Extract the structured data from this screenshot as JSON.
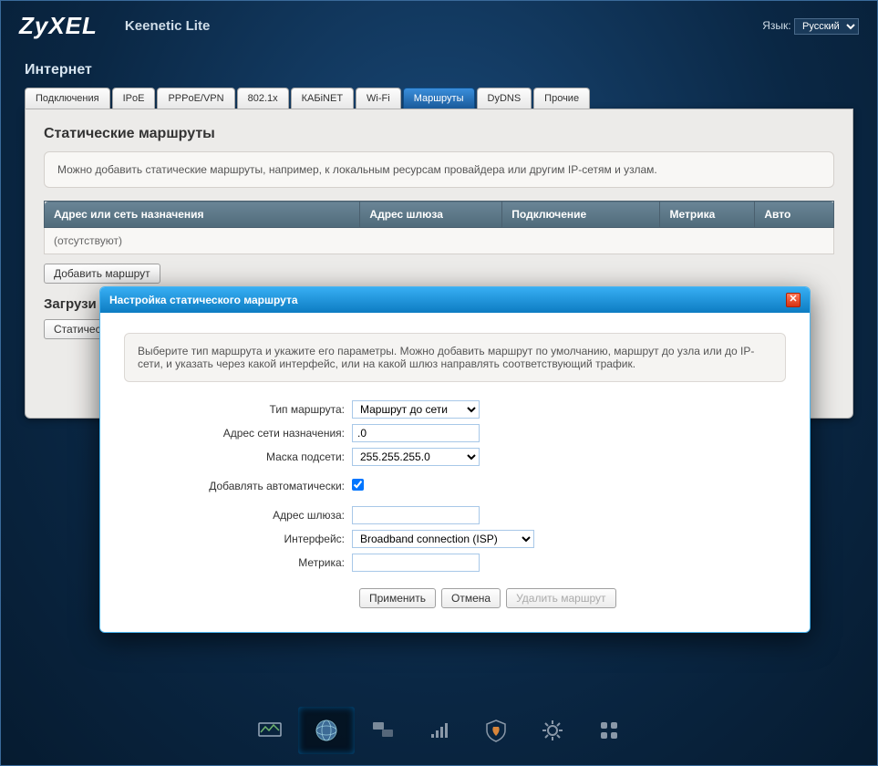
{
  "header": {
    "logo": "ZyXEL",
    "model": "Keenetic Lite",
    "lang_label": "Язык:",
    "lang_value": "Русский"
  },
  "breadcrumb": "Интернет",
  "tabs": [
    {
      "label": "Подключения"
    },
    {
      "label": "IPoE"
    },
    {
      "label": "PPPoE/VPN"
    },
    {
      "label": "802.1x"
    },
    {
      "label": "КАБiNET"
    },
    {
      "label": "Wi-Fi"
    },
    {
      "label": "Маршруты",
      "active": true
    },
    {
      "label": "DyDNS"
    },
    {
      "label": "Прочие"
    }
  ],
  "panel": {
    "title": "Статические маршруты",
    "info": "Можно добавить статические маршруты, например, к локальным ресурсам провайдера или другим IP-сетям и узлам.",
    "columns": {
      "dest": "Адрес или сеть назначения",
      "gateway": "Адрес шлюза",
      "conn": "Подключение",
      "metric": "Метрика",
      "auto": "Авто"
    },
    "empty_row": "(отсутствуют)",
    "add_btn": "Добавить маршрут",
    "load_title": "Загрузи",
    "load_btn_prefix": "Статичес"
  },
  "dialog": {
    "title": "Настройка статического маршрута",
    "info": "Выберите тип маршрута и укажите его параметры. Можно добавить маршрут по умолчанию, маршрут до узла или до IP-сети, и указать через какой интерфейс, или на какой шлюз направлять соответствующий трафик.",
    "fields": {
      "type_label": "Тип маршрута:",
      "type_value": "Маршрут до сети",
      "dest_label": "Адрес сети назначения:",
      "dest_value": ".0",
      "mask_label": "Маска подсети:",
      "mask_value": "255.255.255.0",
      "auto_label": "Добавлять автоматически:",
      "auto_checked": true,
      "gateway_label": "Адрес шлюза:",
      "gateway_value": "",
      "iface_label": "Интерфейс:",
      "iface_value": "Broadband connection (ISP)",
      "metric_label": "Метрика:",
      "metric_value": ""
    },
    "buttons": {
      "apply": "Применить",
      "cancel": "Отмена",
      "delete": "Удалить маршрут"
    }
  },
  "dock": {
    "items": [
      "monitor",
      "globe",
      "clients",
      "wifi",
      "security",
      "system",
      "apps"
    ],
    "active": 1
  }
}
